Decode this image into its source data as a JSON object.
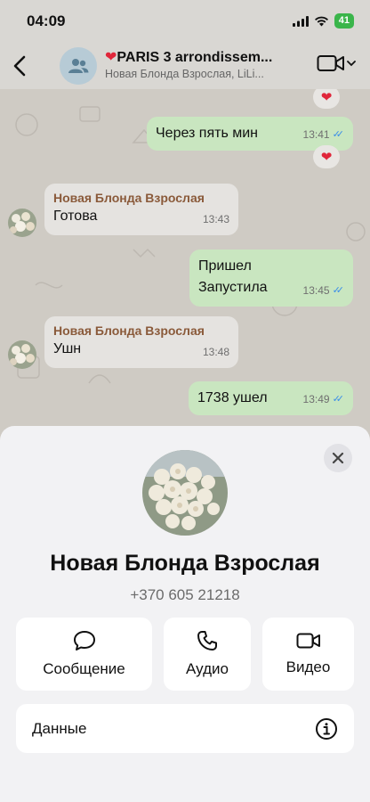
{
  "status_bar": {
    "time": "04:09",
    "battery": "41"
  },
  "header": {
    "title": "PARIS 3 arrondissem...",
    "subtitle": "Новая Блонда Взрослая, LiLi..."
  },
  "messages": [
    {
      "sender": "",
      "text": "Через пять мин",
      "time": "13:41",
      "outgoing": true
    },
    {
      "sender": "Новая Блонда Взрослая",
      "text": "Готова",
      "time": "13:43",
      "outgoing": false
    },
    {
      "sender": "",
      "text": "Пришел\nЗапустила",
      "line1": "Пришел",
      "line2": "Запустила",
      "time": "13:45",
      "outgoing": true
    },
    {
      "sender": "Новая Блонда Взрослая",
      "text": "Ушн",
      "time": "13:48",
      "outgoing": false
    },
    {
      "sender": "",
      "text": "1738 ушел",
      "time": "13:49",
      "outgoing": true
    }
  ],
  "contact": {
    "name": "Новая Блонда Взрослая",
    "phone": "+370 605 21218"
  },
  "actions": [
    {
      "label": "Сообщение",
      "icon": "message-icon"
    },
    {
      "label": "Аудио",
      "icon": "phone-icon"
    },
    {
      "label": "Видео",
      "icon": "video-icon"
    }
  ],
  "details": {
    "label": "Данные",
    "icon": "info-icon"
  },
  "colors": {
    "outgoing_bubble": "#c9e6c0",
    "incoming_bubble": "#e5e3e0",
    "sender_name": "#8a5a3a",
    "read_ticks": "#3a8ee8",
    "battery": "#3ab54a"
  }
}
